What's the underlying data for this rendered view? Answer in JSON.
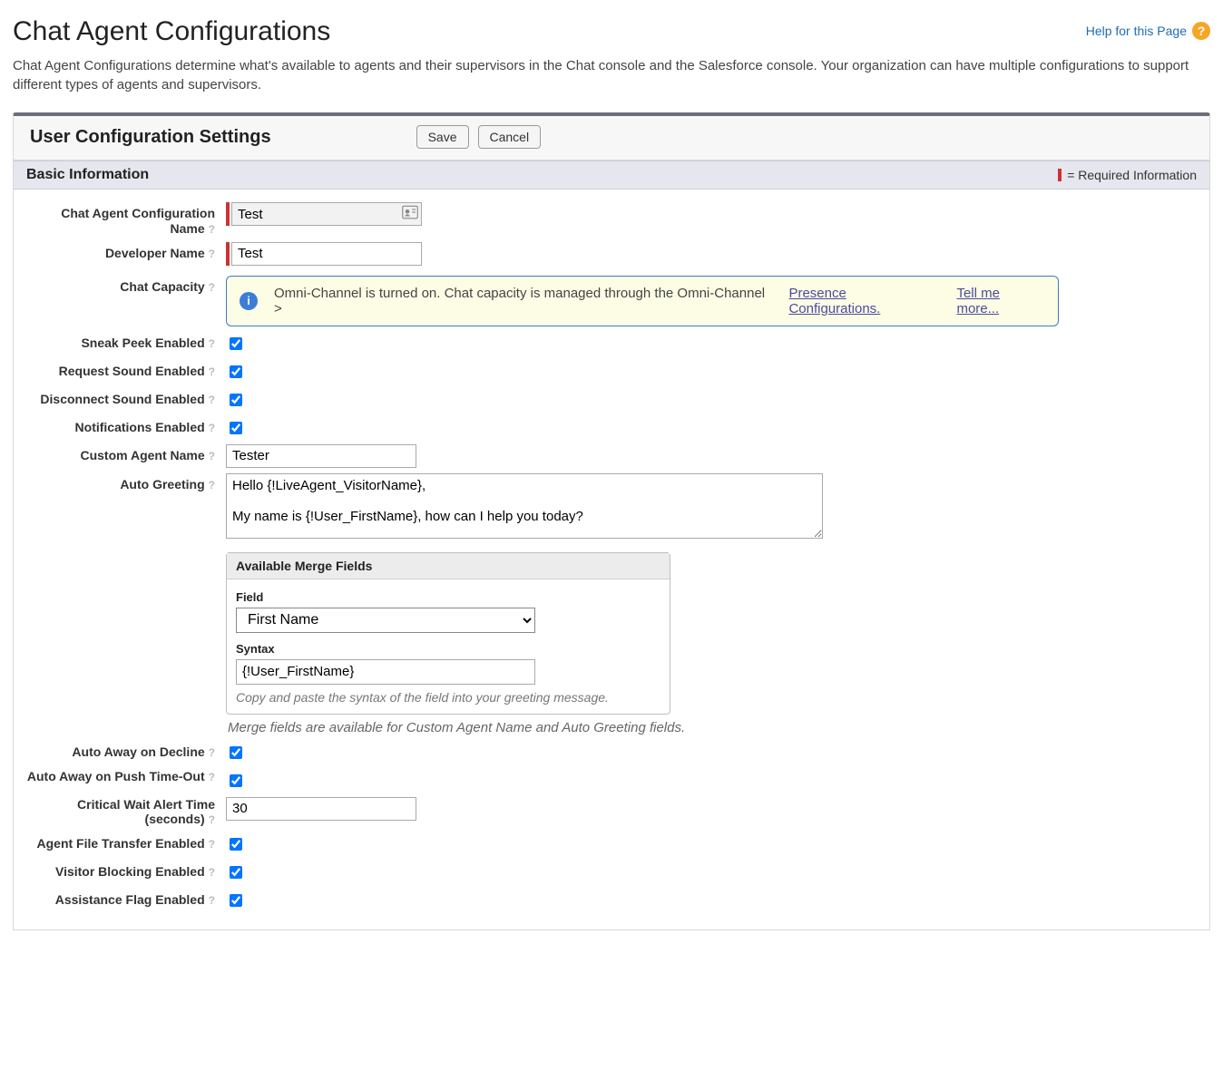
{
  "header": {
    "title": "Chat Agent Configurations",
    "help_link": "Help for this Page",
    "description": "Chat Agent Configurations determine what's available to agents and their supervisors in the Chat console and the Salesforce console. Your organization can have multiple configurations to support different types of agents and supervisors."
  },
  "panel": {
    "title": "User Configuration Settings",
    "save_label": "Save",
    "cancel_label": "Cancel"
  },
  "section": {
    "basic_info": "Basic Information",
    "required_info": "= Required Information"
  },
  "labels": {
    "config_name": "Chat Agent Configuration Name",
    "developer_name": "Developer Name",
    "chat_capacity": "Chat Capacity",
    "sneak_peek": "Sneak Peek Enabled",
    "request_sound": "Request Sound Enabled",
    "disconnect_sound": "Disconnect Sound Enabled",
    "notifications": "Notifications Enabled",
    "custom_agent_name": "Custom Agent Name",
    "auto_greeting": "Auto Greeting",
    "auto_away_decline": "Auto Away on Decline",
    "auto_away_push": "Auto Away on Push Time-Out",
    "critical_wait": "Critical Wait Alert Time (seconds)",
    "agent_file_transfer": "Agent File Transfer Enabled",
    "visitor_blocking": "Visitor Blocking Enabled",
    "assistance_flag": "Assistance Flag Enabled"
  },
  "values": {
    "config_name": "Test",
    "developer_name": "Test",
    "custom_agent_name": "Tester",
    "auto_greeting": "Hello {!LiveAgent_VisitorName},\n\nMy name is {!User_FirstName}, how can I help you today?",
    "critical_wait": "30"
  },
  "infobox": {
    "text": "Omni-Channel is turned on. Chat capacity is managed through the Omni-Channel >",
    "link1": "Presence Configurations.",
    "link2": "Tell me more..."
  },
  "merge": {
    "title": "Available Merge Fields",
    "field_label": "Field",
    "field_value": "First Name",
    "syntax_label": "Syntax",
    "syntax_value": "{!User_FirstName}",
    "hint": "Copy and paste the syntax of the field into your greeting message.",
    "footnote": "Merge fields are available for Custom Agent Name and Auto Greeting fields."
  }
}
